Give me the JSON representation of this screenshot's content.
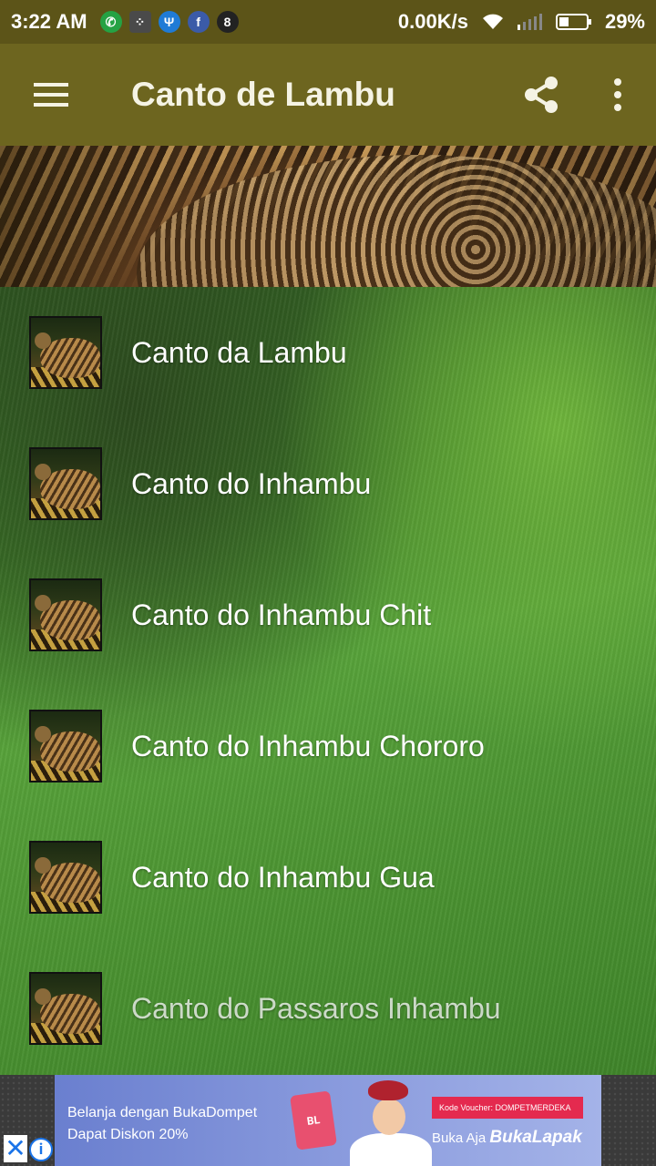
{
  "status_bar": {
    "time": "3:22 AM",
    "notifications": [
      "whatsapp-icon",
      "bbm-icon",
      "usb-icon",
      "facebook-icon",
      "pool-game-icon"
    ],
    "network_speed": "0.00K/s",
    "battery_percent": "29%"
  },
  "app_bar": {
    "title": "Canto de Lambu",
    "menu_icon": "hamburger-menu-icon",
    "share_icon": "share-icon",
    "more_icon": "more-vertical-icon"
  },
  "songs": [
    {
      "label": "Canto da Lambu"
    },
    {
      "label": "Canto do Inhambu"
    },
    {
      "label": "Canto do Inhambu Chit"
    },
    {
      "label": "Canto do Inhambu Chororo"
    },
    {
      "label": "Canto do Inhambu Gua"
    },
    {
      "label": "Canto do Passaros Inhambu"
    }
  ],
  "ad": {
    "line1": "Belanja dengan BukaDompet",
    "line2": "Dapat Diskon 20%",
    "wallet_label": "BL",
    "voucher": "Kode Voucher: DOMPETMERDEKA",
    "cta_prefix": "Buka Aja",
    "cta_brand": "BukaLapak",
    "close": "✕",
    "info": "i"
  }
}
